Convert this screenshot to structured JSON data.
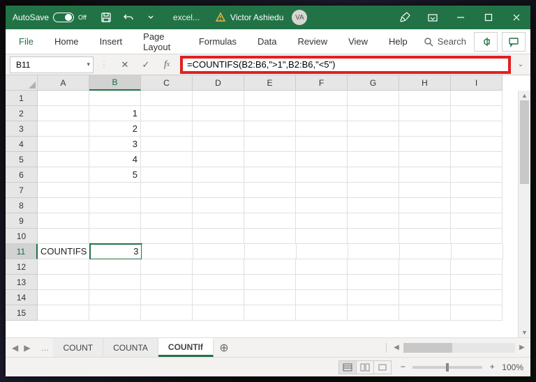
{
  "titlebar": {
    "autosave_label": "AutoSave",
    "autosave_state": "Off",
    "doc_title": "excel...",
    "user_name": "Victor Ashiedu",
    "user_initials": "VA"
  },
  "ribbon": {
    "tabs": [
      "File",
      "Home",
      "Insert",
      "Page Layout",
      "Formulas",
      "Data",
      "Review",
      "View",
      "Help"
    ],
    "search_label": "Search"
  },
  "formula_bar": {
    "name_box": "B11",
    "formula": "=COUNTIFS(B2:B6,\">1\",B2:B6,\"<5\")"
  },
  "grid": {
    "columns": [
      "A",
      "B",
      "C",
      "D",
      "E",
      "F",
      "G",
      "H",
      "I"
    ],
    "row_count_visible": 15,
    "selected_cell": "B11",
    "cells": {
      "B2": "1",
      "B3": "2",
      "B4": "3",
      "B5": "4",
      "B6": "5",
      "A11": "COUNTIFS",
      "B11": "3"
    }
  },
  "sheet_bar": {
    "tabs": [
      "COUNT",
      "COUNTA",
      "COUNTIf"
    ],
    "active_index": 2
  },
  "status_bar": {
    "zoom": "100%"
  }
}
